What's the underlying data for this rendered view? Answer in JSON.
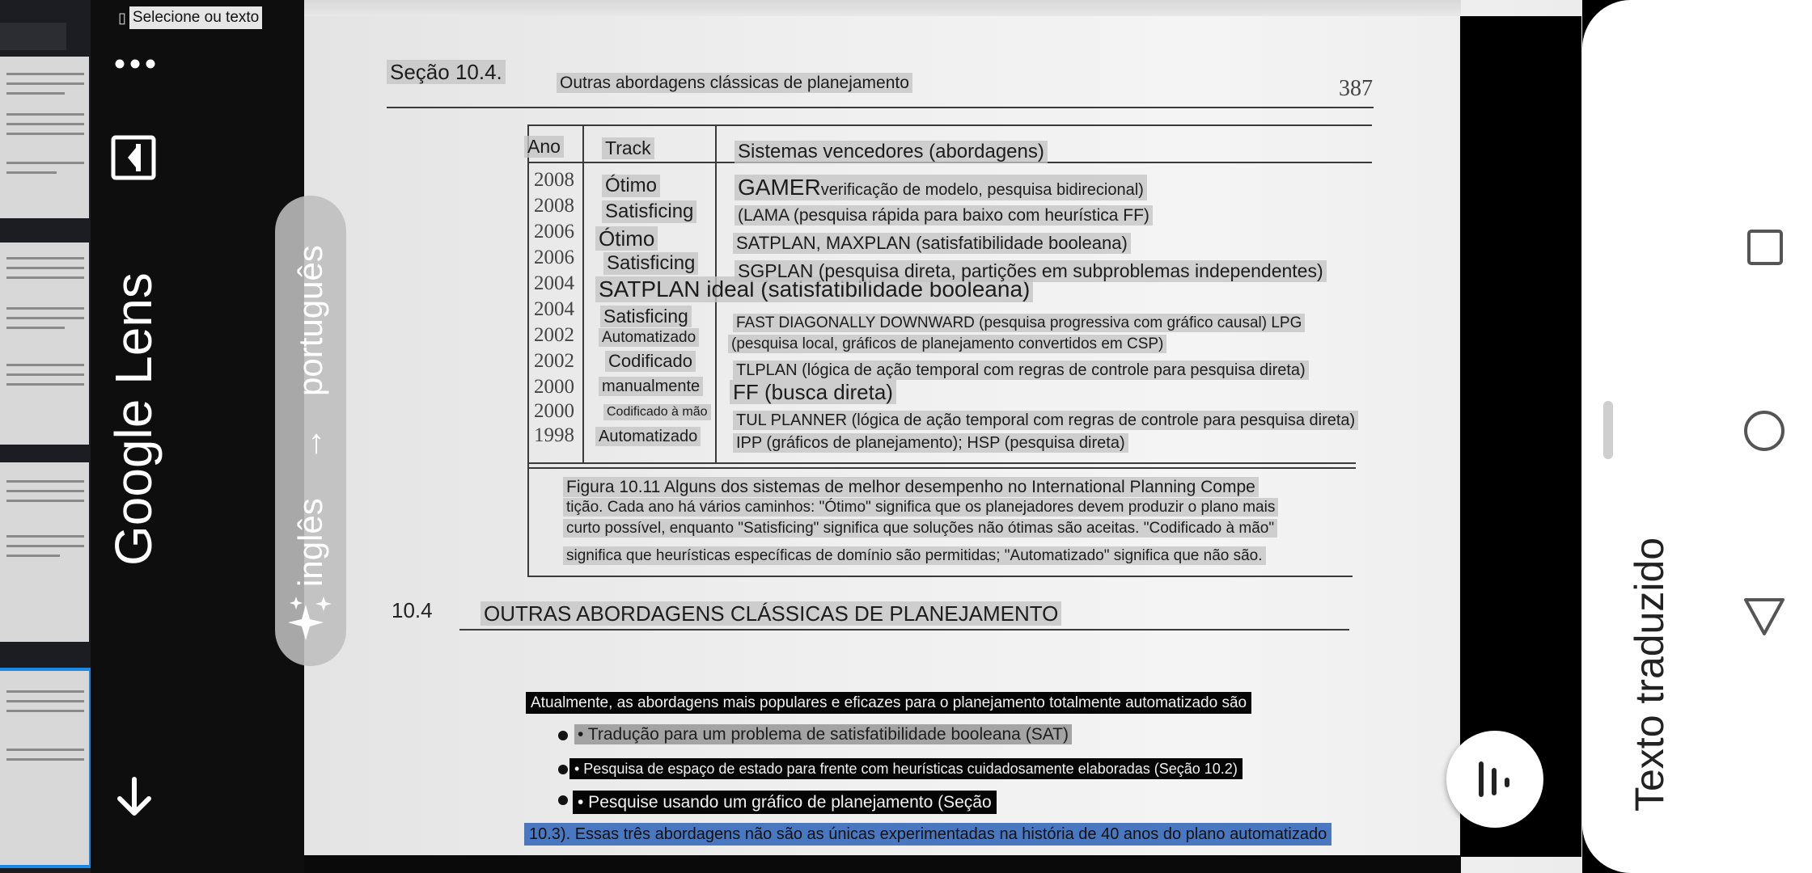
{
  "lens": {
    "title": "Google Lens",
    "select_text": "Selecione ou texto",
    "lang_from": "inglês",
    "lang_arrow": "→",
    "lang_to": "português",
    "translated_label": "Texto traduzido"
  },
  "page": {
    "section": "Seção 10.4.",
    "running_head": "Outras abordagens clássicas de planejamento",
    "page_number": "387",
    "table_headers": [
      "Ano",
      "Track",
      "Sistemas vencedores (abordagens)"
    ],
    "rows": [
      {
        "year": "2008",
        "track": "Ótimo",
        "system_main": "GAMER",
        "system": "verificação de modelo, pesquisa bidirecional)"
      },
      {
        "year": "2008",
        "track": "Satisficing",
        "system_main": "",
        "system": "(LAMA (pesquisa rápida para baixo com heurística FF)"
      },
      {
        "year": "2006",
        "track": "Ótimo",
        "system_main": "",
        "system": "SATPLAN, MAXPLAN (satisfatibilidade booleana)"
      },
      {
        "year": "2006",
        "track": "Satisficing",
        "system_main": "",
        "system": "SGPLAN (pesquisa direta, partições em subproblemas independentes)"
      },
      {
        "year": "2004",
        "track": "SATPLAN ideal (satisfatibilidade booleana)",
        "system_main": "",
        "system": ""
      },
      {
        "year": "2004",
        "track": "Satisficing",
        "system_main": "",
        "system": "FAST DIAGONALLY DOWNWARD (pesquisa progressiva com gráfico causal) LPG"
      },
      {
        "year": "2002",
        "track": "Automatizado",
        "system_main": "",
        "system": "(pesquisa local, gráficos de planejamento convertidos em CSP)"
      },
      {
        "year": "2002",
        "track": "Codificado",
        "system_main": "",
        "system": "TLPLAN (lógica de ação temporal com regras de controle para pesquisa direta)"
      },
      {
        "year": "2000",
        "track": "manualmente",
        "system_main": "FF (busca direta)",
        "system": ""
      },
      {
        "year": "2000",
        "track": "Codificado à mão",
        "system_main": "",
        "system": "TUL PLANNER (lógica de ação temporal com regras de controle para pesquisa direta)"
      },
      {
        "year": "1998",
        "track": "Automatizado",
        "system_main": "",
        "system": "IPP (gráficos de planejamento); HSP (pesquisa direta)"
      }
    ],
    "caption_lines": [
      "Figura 10.11 Alguns dos sistemas de melhor desempenho no International Planning Compe",
      "tição. Cada ano há vários caminhos: \"Ótimo\" significa que os planejadores devem produzir o plano mais",
      "curto possível, enquanto \"Satisficing\" significa que soluções não ótimas são aceitas. \"Codificado à mão\"",
      "significa que heurísticas específicas de domínio são permitidas; \"Automatizado\" significa que não são."
    ],
    "heading_number": "10.4",
    "heading": "OUTRAS ABORDAGENS CLÁSSICAS DE PLANEJAMENTO",
    "para_intro": "Atualmente, as abordagens mais populares e eficazes para o planejamento totalmente automatizado são",
    "bullets": [
      "• Tradução para um problema de satisfatibilidade booleana (SAT)",
      "• Pesquisa de espaço de estado para frente com heurísticas cuidadosamente elaboradas (Seção 10.2)",
      "• Pesquise usando um gráfico de planejamento (Seção"
    ],
    "para_end": "10.3). Essas três abordagens não são as únicas experimentadas na história de 40 anos do plano automatizado"
  },
  "icons": {
    "more": "more-icon",
    "page_toggle": "page-toggle-icon",
    "download": "download-arrow-icon",
    "sparkle": "sparkle-icon",
    "listen": "listen-icon",
    "nav_recents": "square-icon",
    "nav_home": "circle-icon",
    "nav_back": "triangle-icon"
  },
  "colors": {
    "highlight_selected": "#4a78c0",
    "overlay_gray": "#c4c4c4",
    "overlay_dark": "#050505"
  }
}
